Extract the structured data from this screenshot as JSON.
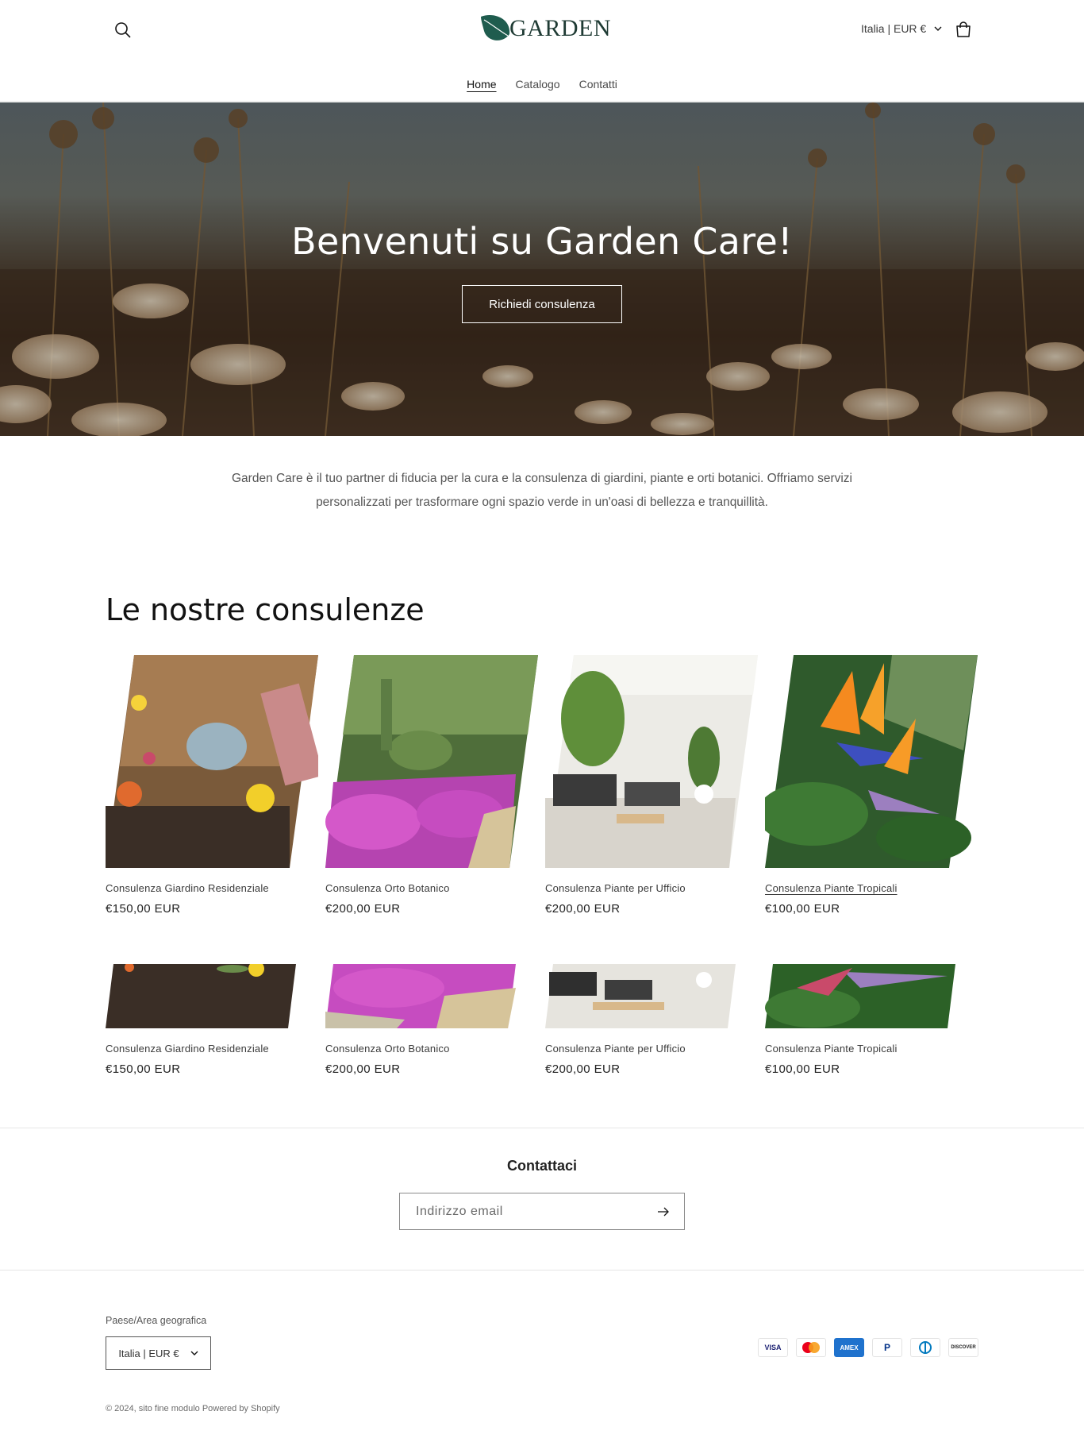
{
  "header": {
    "logo_text": "GARDEN",
    "locale": "Italia | EUR €",
    "nav": [
      "Home",
      "Catalogo",
      "Contatti"
    ]
  },
  "hero": {
    "title": "Benvenuti su Garden Care!",
    "button": "Richiedi consulenza"
  },
  "intro": {
    "text": "Garden Care è il tuo partner di fiducia per la cura e la consulenza di giardini, piante e orti botanici. Offriamo servizi personalizzati per trasformare ogni spazio verde in un'oasi di bellezza e tranquillità."
  },
  "collection": {
    "title": "Le nostre consulenze",
    "products": [
      {
        "title": "Consulenza Giardino Residenziale",
        "price": "€150,00 EUR"
      },
      {
        "title": "Consulenza Orto Botanico",
        "price": "€200,00 EUR"
      },
      {
        "title": "Consulenza Piante per Ufficio",
        "price": "€200,00 EUR"
      },
      {
        "title": "Consulenza Piante Tropicali",
        "price": "€100,00 EUR"
      },
      {
        "title": "Consulenza Giardino Residenziale",
        "price": "€150,00 EUR"
      },
      {
        "title": "Consulenza Orto Botanico",
        "price": "€200,00 EUR"
      },
      {
        "title": "Consulenza Piante per Ufficio",
        "price": "€200,00 EUR"
      },
      {
        "title": "Consulenza Piante Tropicali",
        "price": "€100,00 EUR"
      }
    ]
  },
  "contact": {
    "title": "Contattaci",
    "email_placeholder": "Indirizzo email"
  },
  "footer": {
    "country_label": "Paese/Area geografica",
    "country_value": "Italia | EUR €",
    "payments": [
      "VISA",
      "Mastercard",
      "AMEX",
      "PayPal",
      "Diners",
      "DISCOVER"
    ],
    "copyright": "© 2024, sito fine modulo Powered by Shopify"
  },
  "colors": {
    "logo_green": "#1f5c4e",
    "text": "#121212"
  }
}
